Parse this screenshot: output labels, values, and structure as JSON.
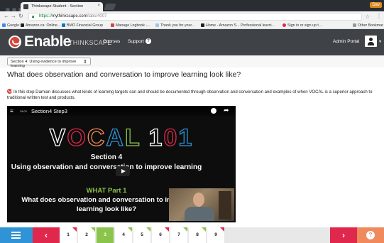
{
  "browser": {
    "tab_title": "Thinkscape Student - Section",
    "user_badge": "Dav",
    "url_secure": "https://",
    "url_host": "mythinkscape.com",
    "url_path": "/labs/4007",
    "bookmarks": [
      {
        "label": "Google",
        "color": "#4285f4"
      },
      {
        "label": "Amazon.ca: Online...",
        "color": "#222222"
      },
      {
        "label": "BMO Financial Group",
        "color": "#0079c1"
      },
      {
        "label": "Manage Logbook -...",
        "color": "#d6463c"
      },
      {
        "label": "Thank you for your...",
        "color": "#9ec7e8"
      },
      {
        "label": "Home - Amazon S...",
        "color": "#222222"
      },
      {
        "label": "Professional learni...",
        "color": "#cccccc"
      },
      {
        "label": "Sign in or sign up t...",
        "color": "#e0274c"
      },
      {
        "label": "Other Bookmar",
        "color": "#999999"
      }
    ]
  },
  "app": {
    "brand": "Enable",
    "brand_sub": "THINKSCAPE",
    "nav_courses": "Courses",
    "nav_support": "Support",
    "admin_portal": "Admin Portal"
  },
  "section_select": {
    "value": "Section 4: Using evidence to improve learning"
  },
  "page": {
    "title": "What does observation and conversation to improve learning look like?",
    "description": "In this step Damian discusses what kinds of learning targets can and should be documented through observation and conversation and examples of when VOCAL is a superior approach to traditional written test and products."
  },
  "video": {
    "time": "28:02",
    "title": "Section4 Step3",
    "vocal_text": "VOCAL 101",
    "section_line": "Section 4",
    "subtitle": "Using observation and conversation to improve learning",
    "part_label": "WHAT Part 1",
    "question": "What does observation and conversation to improve learning look like?"
  },
  "steps": {
    "items": [
      {
        "label": "1",
        "active": false,
        "mark": "red"
      },
      {
        "label": "2",
        "active": false,
        "mark": "green"
      },
      {
        "label": "3",
        "active": true,
        "mark": "none"
      },
      {
        "label": "4",
        "active": false,
        "mark": "green"
      },
      {
        "label": "5",
        "active": false,
        "mark": "green"
      },
      {
        "label": "6",
        "active": false,
        "mark": "red"
      },
      {
        "label": "7",
        "active": false,
        "mark": "green"
      },
      {
        "label": "8",
        "active": false,
        "mark": "green"
      },
      {
        "label": "9",
        "active": false,
        "mark": "red"
      }
    ]
  },
  "colors": {
    "accent_red": "#e0274c",
    "accent_blue": "#2f93d6",
    "accent_green": "#8bc44a",
    "header_bg": "#3f4246"
  }
}
